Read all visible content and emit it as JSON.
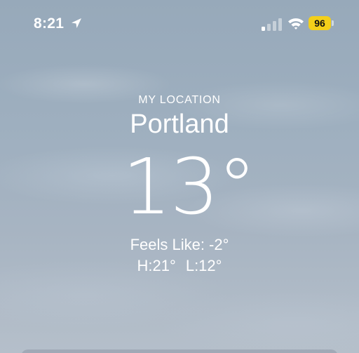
{
  "status_bar": {
    "time": "8:21",
    "battery_level": "96",
    "battery_color": "#f3cf1a",
    "icons": [
      "location-arrow-icon",
      "cellular-signal-icon",
      "wifi-icon",
      "battery-icon"
    ]
  },
  "weather": {
    "location_label": "MY LOCATION",
    "city": "Portland",
    "temperature": "13°",
    "feels_like": "Feels Like: -2°",
    "high": "H:21°",
    "low": "L:12°"
  }
}
